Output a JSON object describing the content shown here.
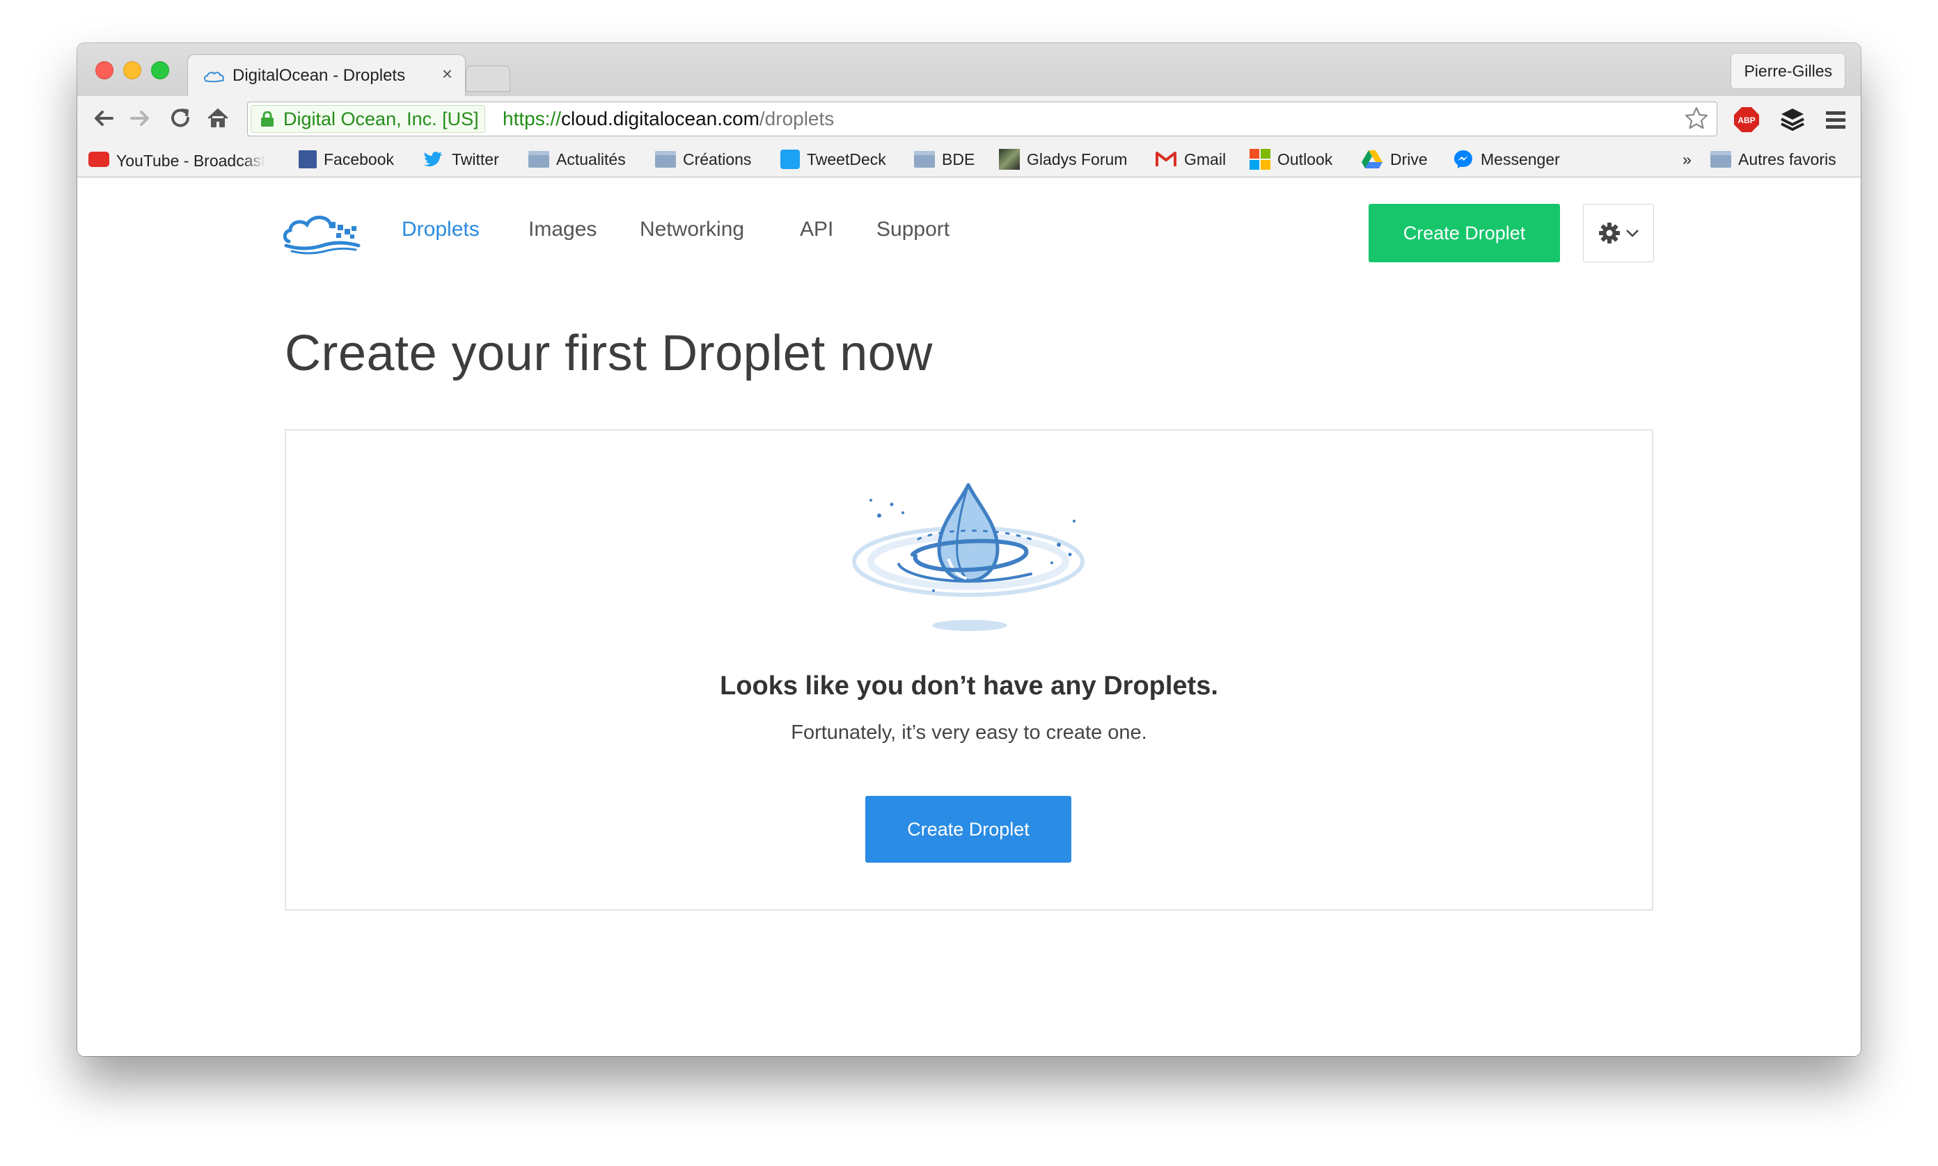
{
  "browser": {
    "tab_title": "DigitalOcean - Droplets",
    "tab_close": "×",
    "profile": "Pierre-Gilles",
    "ev_label": "Digital Ocean, Inc. [US]",
    "url_scheme": "https://",
    "url_host": "cloud.digitalocean.com",
    "url_path": "/droplets",
    "overflow": "»",
    "bookmarks": [
      {
        "label": "YouTube - Broadcast",
        "icon": "youtube-icon"
      },
      {
        "label": "Facebook",
        "icon": "facebook-icon"
      },
      {
        "label": "Twitter",
        "icon": "twitter-icon"
      },
      {
        "label": "Actualités",
        "icon": "folder-icon"
      },
      {
        "label": "Créations",
        "icon": "folder-icon"
      },
      {
        "label": "TweetDeck",
        "icon": "tweetdeck-icon"
      },
      {
        "label": "BDE",
        "icon": "folder-icon"
      },
      {
        "label": "Gladys Forum",
        "icon": "gladys-icon"
      },
      {
        "label": "Gmail",
        "icon": "gmail-icon"
      },
      {
        "label": "Outlook",
        "icon": "outlook-icon"
      },
      {
        "label": "Drive",
        "icon": "drive-icon"
      },
      {
        "label": "Messenger",
        "icon": "messenger-icon"
      },
      {
        "label": "Autres favoris",
        "icon": "folder-icon"
      }
    ],
    "extensions": [
      "adblock-icon",
      "buffer-icon",
      "menu-icon"
    ]
  },
  "nav": {
    "items": [
      "Droplets",
      "Images",
      "Networking",
      "API",
      "Support"
    ],
    "create_button": "Create Droplet"
  },
  "main": {
    "title": "Create your first Droplet now",
    "empty_title": "Looks like you don’t have any Droplets.",
    "empty_sub": "Fortunately, it’s very easy to create one.",
    "create_button": "Create Droplet"
  },
  "colors": {
    "accent_blue": "#2a8ce4",
    "accent_green": "#17c66b",
    "ev_green": "#248d19"
  }
}
